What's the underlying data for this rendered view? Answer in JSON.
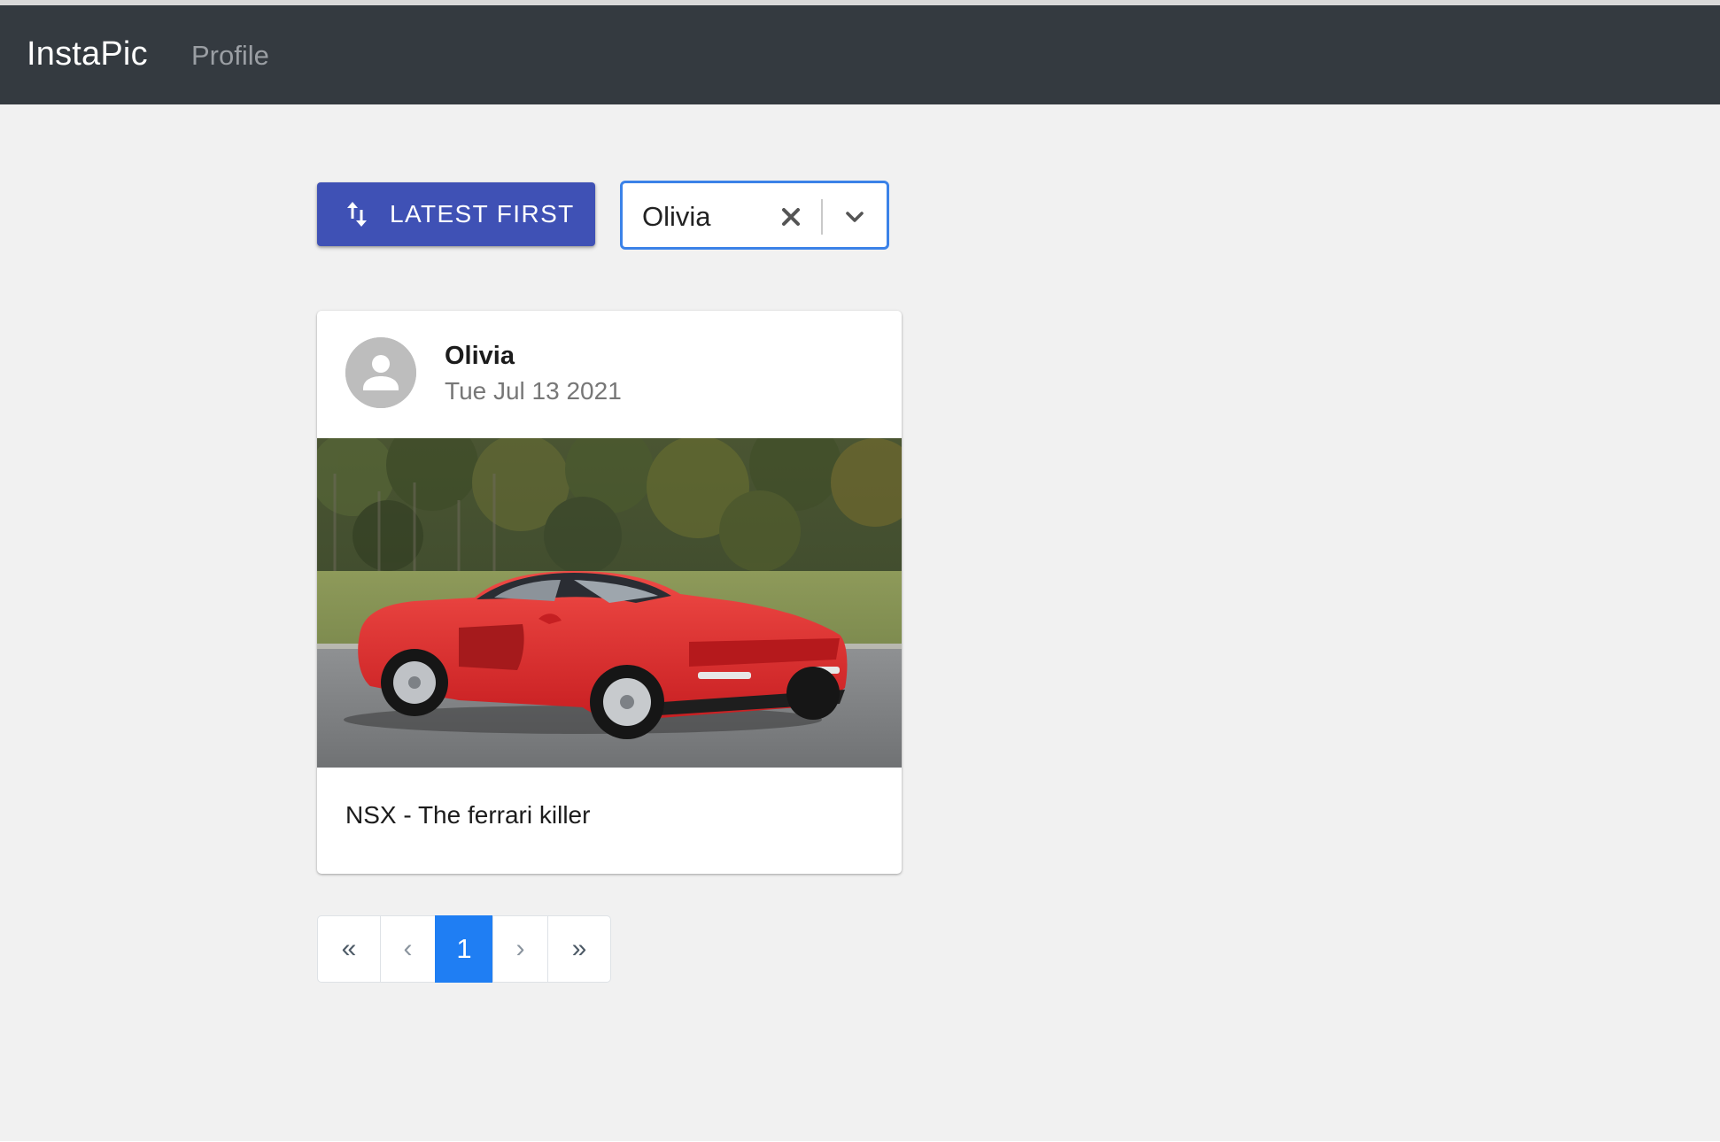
{
  "navbar": {
    "brand": "InstaPic",
    "links": [
      "Profile"
    ],
    "background": "#343a40"
  },
  "toolbar": {
    "sort_button_label": "LATEST FIRST",
    "sort_icon": "swap-vertical-icon",
    "accent": "#3f51b5",
    "user_filter": {
      "selected_value": "Olivia",
      "clear_icon": "close-icon",
      "dropdown_icon": "chevron-down-icon",
      "focus_color": "#3b82e8"
    }
  },
  "posts": [
    {
      "author": "Olivia",
      "date": "Tue Jul 13 2021",
      "avatar_icon": "person-icon",
      "image_subject": "red-sports-car-photo",
      "caption": "NSX - The ferrari killer"
    }
  ],
  "pagination": {
    "first": "«",
    "prev": "‹",
    "current": "1",
    "next": "›",
    "last": "»",
    "active_color": "#1f7ef3"
  }
}
